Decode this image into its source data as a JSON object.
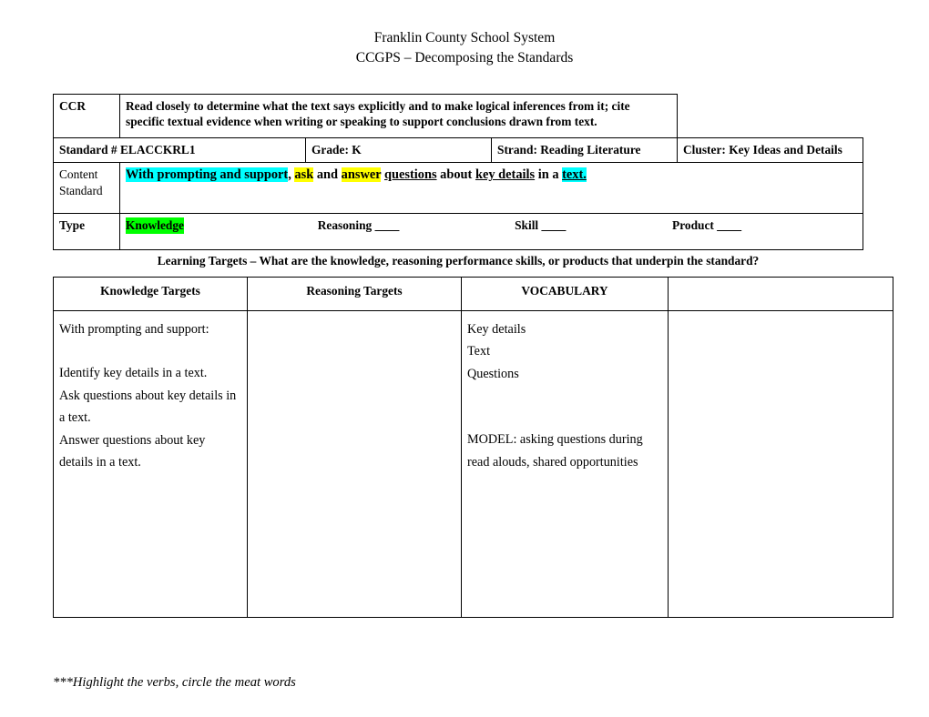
{
  "header": {
    "line1": "Franklin County School System",
    "line2": "CCGPS – Decomposing the Standards"
  },
  "standards_table": {
    "ccr": {
      "label": "CCR",
      "text": "Read closely to determine what the text says explicitly and to make logical inferences from it; cite specific textual evidence when writing or speaking to support conclusions drawn from text."
    },
    "standard_row": {
      "standard": "Standard # ELACCKRL1",
      "grade": "Grade: K",
      "strand": "Strand:  Reading Literature",
      "cluster": "Cluster:  Key Ideas and Details"
    },
    "content_standard": {
      "label_line1": "Content",
      "label_line2": "Standard",
      "full_text": "With prompting and support, ask and answer questions about key details in a text.",
      "segments": [
        {
          "text": "With prompting and support",
          "highlight": "cyan",
          "underline": false
        },
        {
          "text": ", ",
          "highlight": "none",
          "underline": false
        },
        {
          "text": "ask",
          "highlight": "yellow",
          "underline": false
        },
        {
          "text": " and ",
          "highlight": "none",
          "underline": false
        },
        {
          "text": "answer",
          "highlight": "yellow",
          "underline": false
        },
        {
          "text": " ",
          "highlight": "none",
          "underline": false
        },
        {
          "text": "questions",
          "highlight": "none",
          "underline": true
        },
        {
          "text": " about ",
          "highlight": "none",
          "underline": false
        },
        {
          "text": "key details",
          "highlight": "none",
          "underline": true
        },
        {
          "text": " in a ",
          "highlight": "none",
          "underline": false
        },
        {
          "text": "text.",
          "highlight": "cyan",
          "underline": true
        }
      ]
    },
    "type_row": {
      "label": "Type",
      "knowledge": "Knowledge",
      "reasoning": "Reasoning",
      "skill": "Skill",
      "product": "Product",
      "blank": "____"
    }
  },
  "learning_targets_caption": "Learning Targets – What are the knowledge, reasoning performance skills, or products that underpin the standard?",
  "targets_table": {
    "headers": [
      "Knowledge Targets",
      "Reasoning Targets",
      "VOCABULARY",
      ""
    ],
    "knowledge_targets_lines": [
      "With prompting and support:",
      "",
      "Identify key details in a text.",
      "Ask questions about key details in a text.",
      "Answer questions about key details in a text."
    ],
    "reasoning_targets_lines": [],
    "vocabulary_lines": [
      "Key details",
      "Text",
      "Questions",
      "",
      "",
      "MODEL:  asking questions during read alouds, shared opportunities"
    ],
    "fourth_column_lines": []
  },
  "footer_note": "***Highlight the verbs, circle the meat words",
  "colors": {
    "cyan_highlight": "#00ffff",
    "yellow_highlight": "#ffff00",
    "green_highlight": "#00ff00",
    "border": "#000000",
    "text": "#000000",
    "background": "#ffffff"
  }
}
